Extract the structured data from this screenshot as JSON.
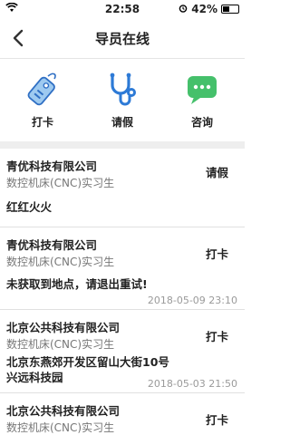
{
  "status": {
    "time": "22:58",
    "battery": "42%",
    "battery_level": 0.42
  },
  "nav": {
    "title": "导员在线"
  },
  "actions": [
    {
      "label": "打卡",
      "icon": "tag-icon",
      "color": "#3b7ed8"
    },
    {
      "label": "请假",
      "icon": "stethoscope-icon",
      "color": "#2d7ad6"
    },
    {
      "label": "咨询",
      "icon": "chat-icon",
      "color": "#45c06b"
    }
  ],
  "records": [
    {
      "company": "青优科技有限公司",
      "role": "数控机床(CNC)实习生",
      "type": "请假",
      "note": "红红火火",
      "time": ""
    },
    {
      "company": "青优科技有限公司",
      "role": "数控机床(CNC)实习生",
      "type": "打卡",
      "note": "未获取到地点，请退出重试!",
      "time": "2018-05-09 23:10"
    },
    {
      "company": "北京公共科技有限公司",
      "role": "数控机床(CNC)实习生",
      "type": "打卡",
      "note": "北京东燕郊开发区留山大街10号兴远科技园",
      "time": "2018-05-03 21:50"
    },
    {
      "company": "北京公共科技有限公司",
      "role": "数控机床(CNC)实习生",
      "type": "打卡",
      "note": "",
      "time": ""
    }
  ]
}
